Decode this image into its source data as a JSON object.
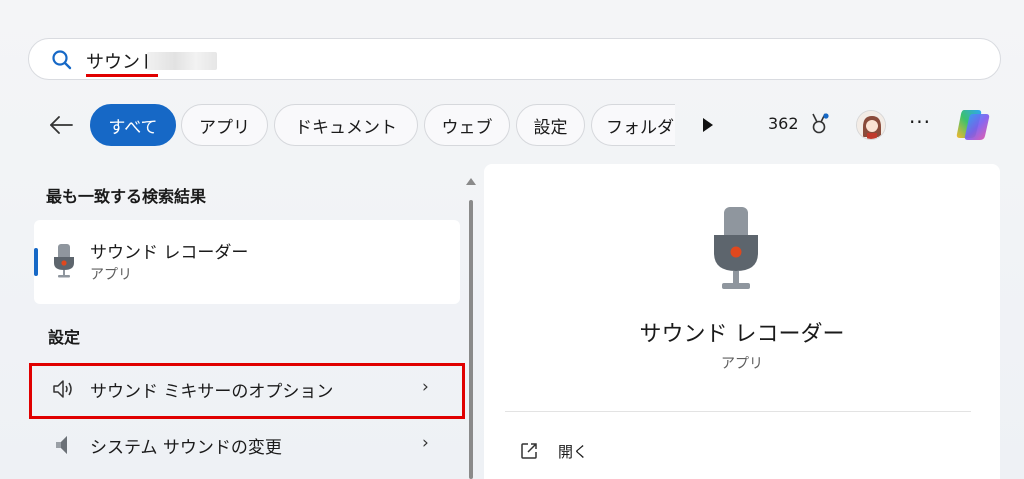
{
  "search": {
    "query": "サウンド",
    "icon": "search-icon"
  },
  "filters": {
    "back_icon": "arrow-left-icon",
    "chips": [
      {
        "label": "すべて",
        "active": true
      },
      {
        "label": "アプリ",
        "active": false
      },
      {
        "label": "ドキュメント",
        "active": false
      },
      {
        "label": "ウェブ",
        "active": false
      },
      {
        "label": "設定",
        "active": false
      },
      {
        "label": "フォルダ",
        "active": false
      }
    ],
    "more_filters_icon": "play-icon"
  },
  "header_right": {
    "points": "362",
    "points_icon": "medal-icon",
    "avatar": "avatar",
    "more_icon": "···",
    "copilot_icon": "copilot-icon"
  },
  "results": {
    "best_match_heading": "最も一致する検索結果",
    "best_match": {
      "title": "サウンド レコーダー",
      "subtitle": "アプリ",
      "icon": "microphone-icon"
    },
    "settings_heading": "設定",
    "settings_items": [
      {
        "label": "サウンド ミキサーのオプション",
        "icon": "speaker-icon",
        "chevron": "›"
      },
      {
        "label": "システム サウンドの変更",
        "icon": "speaker-gray-icon",
        "chevron": "›"
      }
    ]
  },
  "detail": {
    "title": "サウンド レコーダー",
    "subtitle": "アプリ",
    "icon": "microphone-icon",
    "actions": [
      {
        "label": "開く",
        "icon": "open-external-icon"
      }
    ]
  },
  "colors": {
    "accent": "#1668c6",
    "highlight": "#e00000",
    "recorder_red": "#e0481e"
  }
}
